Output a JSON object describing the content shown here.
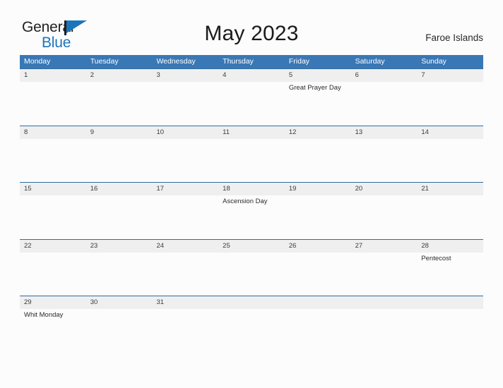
{
  "brand": {
    "name_part1": "General",
    "name_part2": "Blue",
    "flag_icon": "blue-flag-icon",
    "color_dark": "#231f20",
    "color_blue": "#1b75bb"
  },
  "header": {
    "title": "May 2023",
    "region": "Faroe Islands"
  },
  "theme": {
    "header_blue": "#3a77b5",
    "row_divider_blue": "#2e6da4",
    "daystrip_gray": "#efefef",
    "page_background": "#fcfcfc"
  },
  "calendar": {
    "month": "May",
    "year": "2023",
    "weekday_headers": [
      "Monday",
      "Tuesday",
      "Wednesday",
      "Thursday",
      "Friday",
      "Saturday",
      "Sunday"
    ],
    "weeks": [
      {
        "days": [
          {
            "number": "1",
            "event": ""
          },
          {
            "number": "2",
            "event": ""
          },
          {
            "number": "3",
            "event": ""
          },
          {
            "number": "4",
            "event": ""
          },
          {
            "number": "5",
            "event": "Great Prayer Day"
          },
          {
            "number": "6",
            "event": ""
          },
          {
            "number": "7",
            "event": ""
          }
        ]
      },
      {
        "days": [
          {
            "number": "8",
            "event": ""
          },
          {
            "number": "9",
            "event": ""
          },
          {
            "number": "10",
            "event": ""
          },
          {
            "number": "11",
            "event": ""
          },
          {
            "number": "12",
            "event": ""
          },
          {
            "number": "13",
            "event": ""
          },
          {
            "number": "14",
            "event": ""
          }
        ]
      },
      {
        "days": [
          {
            "number": "15",
            "event": ""
          },
          {
            "number": "16",
            "event": ""
          },
          {
            "number": "17",
            "event": ""
          },
          {
            "number": "18",
            "event": "Ascension Day"
          },
          {
            "number": "19",
            "event": ""
          },
          {
            "number": "20",
            "event": ""
          },
          {
            "number": "21",
            "event": ""
          }
        ]
      },
      {
        "days": [
          {
            "number": "22",
            "event": ""
          },
          {
            "number": "23",
            "event": ""
          },
          {
            "number": "24",
            "event": ""
          },
          {
            "number": "25",
            "event": ""
          },
          {
            "number": "26",
            "event": ""
          },
          {
            "number": "27",
            "event": ""
          },
          {
            "number": "28",
            "event": "Pentecost"
          }
        ]
      },
      {
        "days": [
          {
            "number": "29",
            "event": "Whit Monday"
          },
          {
            "number": "30",
            "event": ""
          },
          {
            "number": "31",
            "event": ""
          },
          {
            "number": "",
            "event": ""
          },
          {
            "number": "",
            "event": ""
          },
          {
            "number": "",
            "event": ""
          },
          {
            "number": "",
            "event": ""
          }
        ]
      }
    ]
  }
}
